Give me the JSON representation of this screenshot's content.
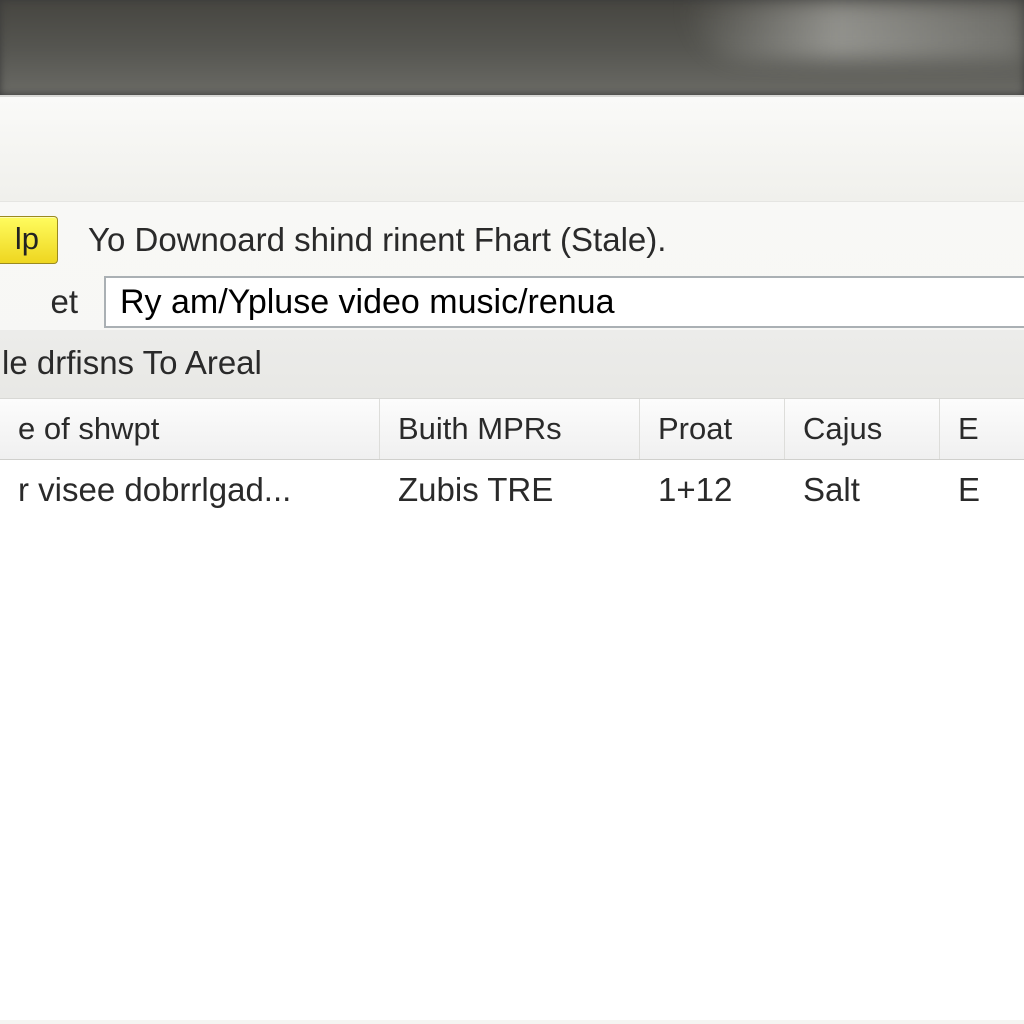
{
  "toolbar": {
    "button_label": "lp",
    "status_text": "Yo Downoard shind rinent Fhart (Stale)."
  },
  "input": {
    "label": "et",
    "value": "Ry am/Ypluse video music/renua"
  },
  "sublabel": "le drfisns To Areal",
  "table": {
    "headers": {
      "c1": "e of shwpt",
      "c2": "Buith MPRs",
      "c3": "Proat",
      "c4": "Cajus",
      "c5": "E"
    },
    "rows": [
      {
        "c1": "r visee dobrrlgad...",
        "c2": "Zubis TRE",
        "c3": "1+12",
        "c4": "Salt",
        "c5": "E"
      }
    ]
  }
}
